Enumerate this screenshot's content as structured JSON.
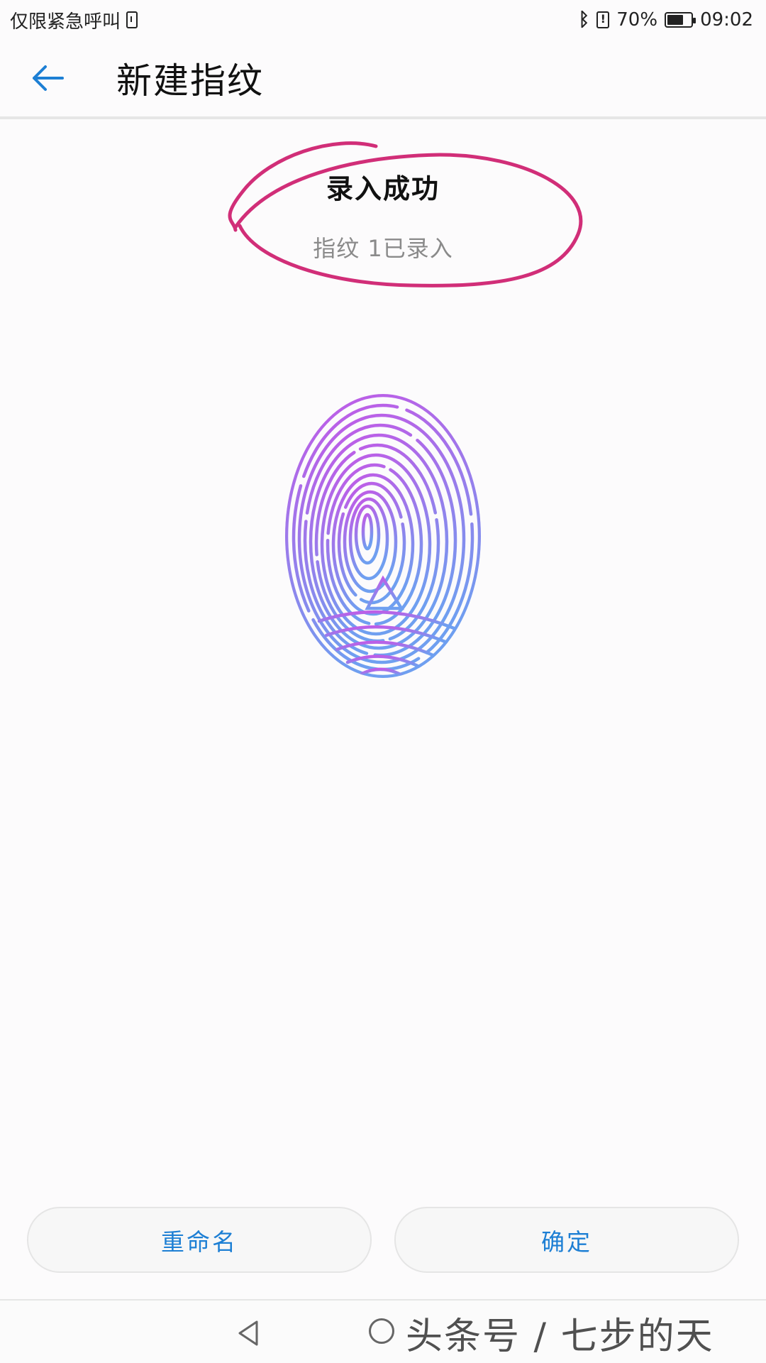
{
  "status_bar": {
    "carrier_text": "仅限紧急呼叫",
    "battery": "70%",
    "time": "09:02",
    "battery_level": 0.7
  },
  "header": {
    "title": "新建指纹"
  },
  "result": {
    "title": "录入成功",
    "subtitle": "指纹 1已录入"
  },
  "buttons": {
    "rename": "重命名",
    "confirm": "确定"
  },
  "watermark": {
    "text": "头条号 / 七步的天"
  },
  "colors": {
    "accent_blue": "#1d7fd4",
    "annotation": "#d12e78",
    "fingerprint_top": "#c458e6",
    "fingerprint_bottom": "#6f9ff0"
  },
  "icons": {
    "back": "arrow-left-icon",
    "fingerprint": "fingerprint-icon",
    "nav_back": "triangle-back-icon",
    "nav_home": "circle-home-icon"
  }
}
